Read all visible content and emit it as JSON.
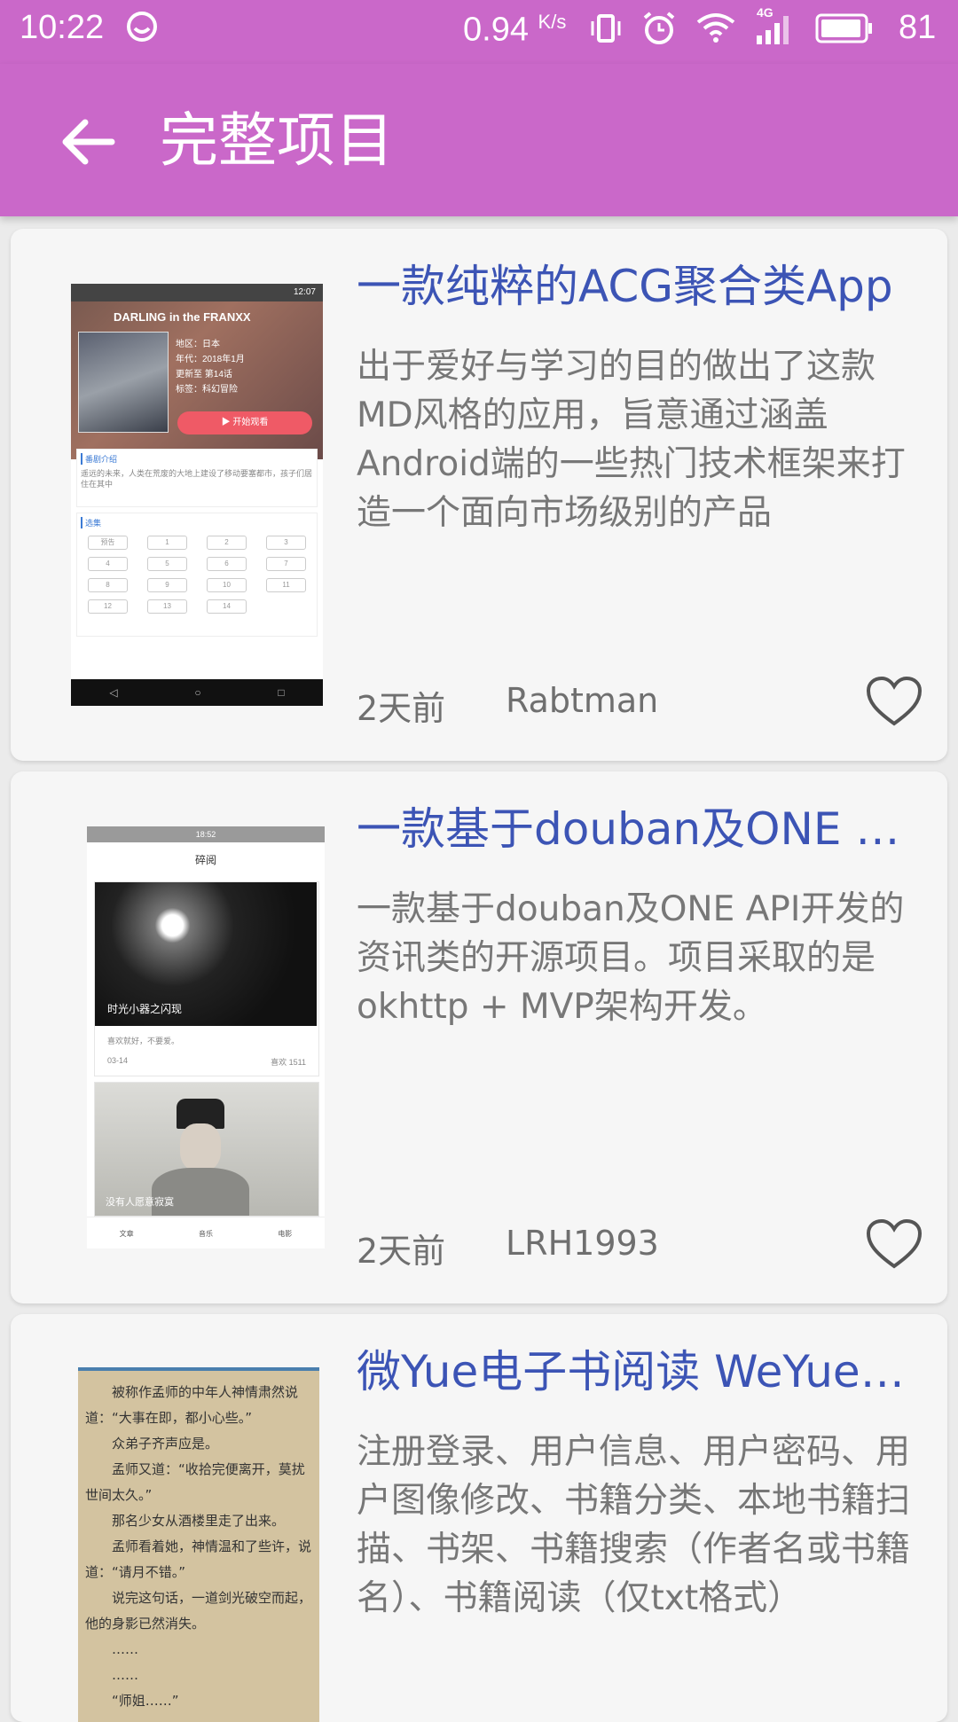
{
  "status_bar": {
    "time": "10:22",
    "speed": "0.94",
    "speed_unit": "K/s",
    "network_type": "4G",
    "battery": "81",
    "icons": [
      "face-icon",
      "vibrate-icon",
      "alarm-icon",
      "wifi-icon",
      "signal-icon",
      "battery-icon"
    ]
  },
  "app_bar": {
    "title": "完整项目",
    "back_icon": "arrow-left-icon"
  },
  "colors": {
    "primary": "#ca68c9",
    "title_blue": "#3c54b5",
    "text_gray": "#777777",
    "background": "#ebebeb",
    "card": "#f6f6f6"
  },
  "projects": [
    {
      "title": "一款纯粹的ACG聚合类App",
      "description": "出于爱好与学习的目的做出了这款MD风格的应用，旨意通过涵盖Android端的一些热门技术框架来打造一个面向市场级别的产品",
      "time": "2天前",
      "author": "Rabtman",
      "thumb": {
        "time": "12:07",
        "anime_title": "DARLING in the FRANXX",
        "info": [
          "地区：日本",
          "年代：2018年1月",
          "更新至 第14话",
          "标签：科幻冒险"
        ],
        "play": "开始观看",
        "intro_label": "番剧介绍",
        "intro_text": "遥远的未来，人类在荒废的大地上建设了移动要塞都市，孩子们居住在其中",
        "episodes_label": "选集",
        "episodes": [
          "预告",
          "1",
          "2",
          "3",
          "4",
          "5",
          "6",
          "7",
          "8",
          "9",
          "10",
          "11",
          "12",
          "13",
          "14"
        ]
      }
    },
    {
      "title": "一款基于douban及ONE API开发的资讯类的开源项目",
      "description": "一款基于douban及ONE API开发的资讯类的开源项目。项目采取的是okhttp + MVP架构开发。",
      "time": "2天前",
      "author": "LRH1993",
      "thumb": {
        "time": "18:52",
        "header": "碎阅",
        "card1_title": "时光小器之闪现",
        "card1_text": "喜欢就好，不要爱。",
        "card1_date": "03-14",
        "card1_likes": "喜欢 1511",
        "card2_title": "没有人愿意寂寞",
        "nav": [
          "文章",
          "音乐",
          "电影"
        ]
      }
    },
    {
      "title": "微Yue电子书阅读 WeYueReader",
      "description": "注册登录、用户信息、用户密码、用户图像修改、书籍分类、本地书籍扫描、书架、书籍搜索（作者名或书籍名）、书籍阅读（仅txt格式）",
      "thumb": {
        "lines": [
          "被称作孟师的中年人神情肃然说道：“大事在即，都小心些。”",
          "众弟子齐声应是。",
          "孟师又道：“收拾完便离开，莫扰世间太久。”",
          "那名少女从酒楼里走了出来。",
          "孟师看着她，神情温和了些许，说道：“请月不错。”",
          "说完这句话，一道剑光破空而起，他的身影已然消失。",
          "……",
          "……",
          "“师姐……”"
        ]
      }
    }
  ]
}
